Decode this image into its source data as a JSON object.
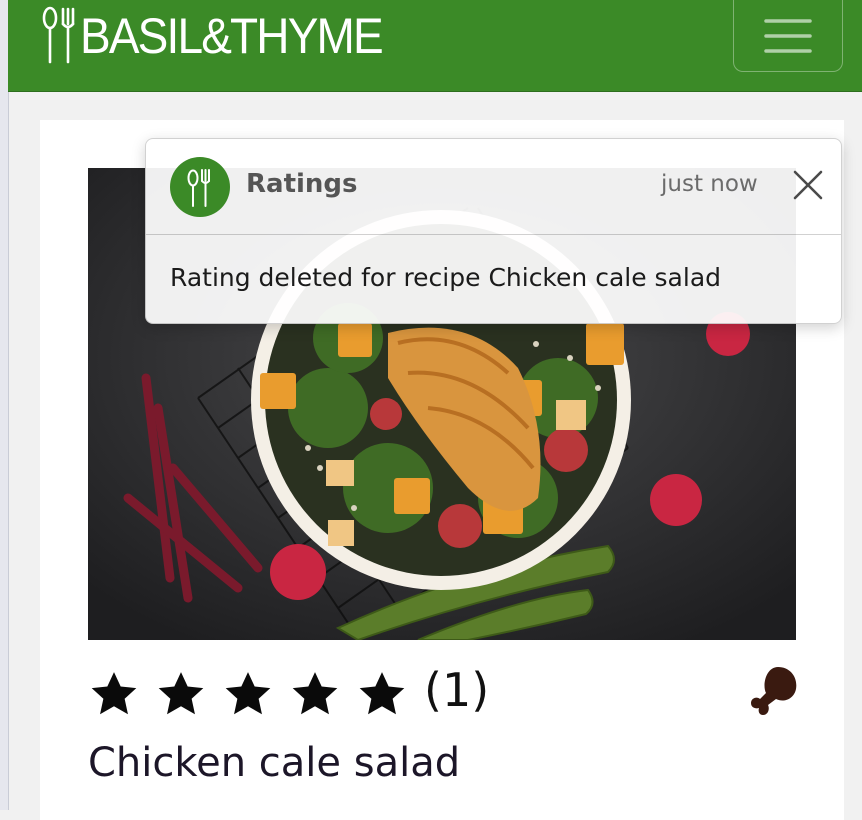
{
  "brand": {
    "name": "BASIL&THYME",
    "color": "#3b8a27",
    "icon": "spoon-fork-icon"
  },
  "navbar": {
    "toggle_icon": "hamburger-menu-icon"
  },
  "toast": {
    "title": "Ratings",
    "time": "just now",
    "message": "Rating deleted for recipe Chicken cale salad",
    "logo_icon": "spoon-fork-icon",
    "close_icon": "close-icon"
  },
  "recipe": {
    "title": "Chicken cale salad",
    "rating_stars": 5,
    "rating_count": "(1)",
    "category_icon": "drumstick-icon"
  }
}
